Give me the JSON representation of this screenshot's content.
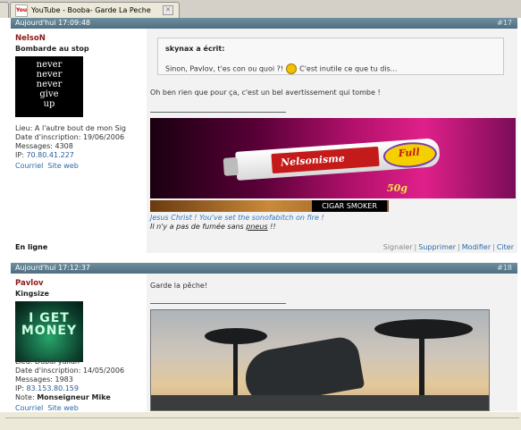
{
  "browser": {
    "tab_title": "YouTube - Booba- Garde La Peche",
    "tab_icon": "youtube-favicon",
    "tab_icon_text": "You"
  },
  "posts": [
    {
      "date": "Aujourd'hui 17:09:48",
      "number": "#17",
      "author": {
        "name": "NelsoN",
        "rank": "Bombarde au stop",
        "avatar_lines": [
          "never",
          "never",
          "never",
          "give",
          "up"
        ],
        "location_label": "Lieu:",
        "location": "A l'autre bout de mon Sig",
        "joined_label": "Date d'inscription:",
        "joined": "19/06/2006",
        "messages_label": "Messages:",
        "messages": "4308",
        "ip_label": "IP:",
        "ip": "70.80.41.227",
        "link_email": "Courriel",
        "link_site": "Site web",
        "status": "En ligne"
      },
      "quote": {
        "header": "skynax a écrit:",
        "text_before": "Sinon, Pavlov, t'es con ou quoi ?!",
        "text_after": "C'est inutile ce que tu dis..."
      },
      "text": "Oh ben rien que pour ça, c'est un bel avertissement qui tombe !",
      "signature": {
        "banner_brand": "Nelsonisme",
        "banner_badge": "Full",
        "banner_weight": "50g",
        "cigar_label": "CIGAR SMOKER",
        "line1": "Jesus Christ ! You've set the sonofabitch on fire !",
        "line2_before": "Il n'y a pas de fumée sans",
        "line2_link": "pneus",
        "line2_after": "!!"
      },
      "actions": [
        "Signaler",
        "Supprimer",
        "Modifier",
        "Citer"
      ]
    },
    {
      "date": "Aujourd'hui 17:12:37",
      "number": "#18",
      "author": {
        "name": "Pavlov",
        "rank": "Kingsize",
        "avatar_lines": [
          "I GET",
          "MONEY"
        ],
        "location_label": "Lieu:",
        "location": "Dubai yallah",
        "joined_label": "Date d'inscription:",
        "joined": "14/05/2006",
        "messages_label": "Messages:",
        "messages": "1983",
        "ip_label": "IP:",
        "ip": "83.153.80.159",
        "note_label": "Note:",
        "note": "Monseigneur Mike",
        "link_email": "Courriel",
        "link_site": "Site web"
      },
      "text": "Garde la pêche!"
    }
  ]
}
